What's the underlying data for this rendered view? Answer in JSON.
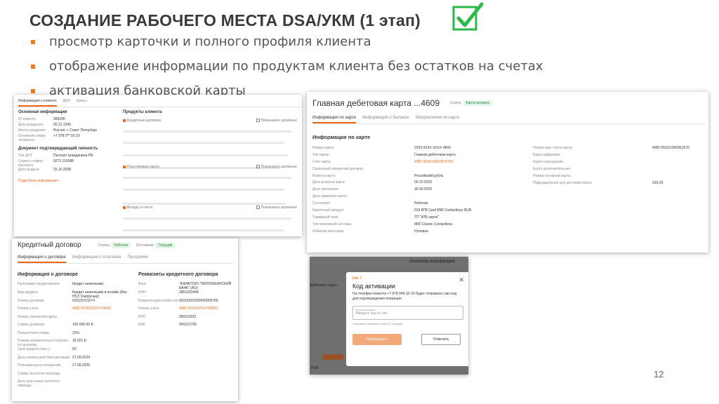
{
  "slide": {
    "title": "СОЗДАНИЕ РАБОЧЕГО МЕСТА DSA/УКМ (1 этап)",
    "bullets": [
      "просмотр карточки и полного профиля клиента",
      "отображение информации по продуктам клиента без остатков на счетах",
      "активация банковской карты"
    ],
    "page_number": "12",
    "accent_color": "#f07c1f",
    "check_color": "#2eb84a"
  },
  "client_card": {
    "tabs": [
      "Информация о клиенте",
      "ДБО",
      "Кросы"
    ],
    "basic_title": "Основная информация",
    "basic_rows": [
      {
        "label": "ID клиента",
        "value": "389290"
      },
      {
        "label": "Дата рождения",
        "value": "05.12.1990"
      },
      {
        "label": "Место рождения",
        "value": "Россия, г. Санкт-Петербург"
      },
      {
        "label": "Основной номер телефона",
        "value": "+7 978 0** 02-23"
      }
    ],
    "doc_title": "Документ подтверждающий личность",
    "doc_rows": [
      {
        "label": "Тип ДУЛ",
        "value": "Паспорт гражданина РФ"
      },
      {
        "label": "Серия и номер паспорта",
        "value": "9273 110288"
      },
      {
        "label": "Дата выдачи",
        "value": "25.10.2008"
      }
    ],
    "more_link": "Подробная информация",
    "products_title": "Продукты клиента",
    "credit_section": "Кредитные договора",
    "cards_section": "Пластиковые карты",
    "deposits_section": "Вклады и счета",
    "show_archive": "Показывать архивные"
  },
  "debit_card": {
    "title": "Главная дебетовая карта ...4609",
    "status_label": "Статус:",
    "status_value": "Карта активна",
    "tabs": [
      "Информация по карте",
      "Информация о балансе",
      "Уведомления по карте"
    ],
    "section_title": "Информация по карте",
    "left_rows": [
      {
        "label": "Номер карты",
        "value": "2200 02XX XXXX 4609"
      },
      {
        "label": "Тип карты",
        "value": "Главная дебетовая карта"
      },
      {
        "label": "Счет карты",
        "value": "40817810210003615765"
      },
      {
        "label": "Связанный кредитный договор",
        "value": ""
      },
      {
        "label": "Валюта карты",
        "value": "Российский рубль"
      },
      {
        "label": "Дата выпуска карты",
        "value": "09.10.2023"
      },
      {
        "label": "Дата окончания",
        "value": "30.09.2029"
      },
      {
        "label": "Дата закрытия карты",
        "value": ""
      },
      {
        "label": "Состояние",
        "value": "Рабочая"
      },
      {
        "label": "Карточный продукт",
        "value": "019 ATB Card MIR Contactless RUR"
      },
      {
        "label": "Тарифный план",
        "value": "ТП \"АТБ карта\""
      },
      {
        "label": "Тип платежной системы",
        "value": "MIR Classic Contactless"
      },
      {
        "label": "Иобиная категория",
        "value": "Нулевая"
      }
    ],
    "right_rows": [
      {
        "label": "Номер карт счета карты",
        "value": "4081781021000361576"
      },
      {
        "label": "Карта цифровая",
        "value": ""
      },
      {
        "label": "Карта сокращения",
        "value": ""
      },
      {
        "label": "Карта дополнительная",
        "value": ""
      },
      {
        "label": "Номер основной карты",
        "value": ""
      },
      {
        "label": "Подразделение для доставки карты",
        "value": "019-25"
      }
    ]
  },
  "credit_contract": {
    "title": "Кредитный договор",
    "status_label": "Статус:",
    "status_value": "Рабочая",
    "state_label": "Состояние:",
    "state_value": "Текущий",
    "tabs": [
      "Информация о договоре",
      "Информация о платежах",
      "Просрочки"
    ],
    "left_title": "Информация о договоре",
    "left_rows": [
      {
        "label": "Программа кредитования",
        "value": "Кредит наличными"
      },
      {
        "label": "Вид кредита",
        "value": "Кредит наличными в онлайн (Без НСЗ (Чапручка))"
      },
      {
        "label": "Номер договора",
        "value": "0151/0151074"
      },
      {
        "label": "Номер счета",
        "value": "40817810621510766581"
      },
      {
        "label": "Номер связанной карты",
        "value": ""
      },
      {
        "label": "Сумма договора",
        "value": "100 000,00 ₽"
      },
      {
        "label": "Процентная ставка",
        "value": "23%"
      },
      {
        "label": "Размер ежемесячного платежа по договору",
        "value": "18 921 ₽"
      },
      {
        "label": "Срок кредита (мес.)",
        "value": "60"
      },
      {
        "label": "Дата начала действия договора",
        "value": "27.09.2024"
      },
      {
        "label": "Плановая дата погашения",
        "value": "27.09.2029"
      },
      {
        "label": "Сумма льготного периода",
        "value": ""
      },
      {
        "label": "Дата окончания льготного периода",
        "value": ""
      }
    ],
    "right_title": "Реквизиты кредитного договора",
    "right_rows": [
      {
        "label": "Банк",
        "value": "\"АЗИАТСКО-ТИХООКЕАНСКИЙ БАНК\" (АО)"
      },
      {
        "label": "ИНН",
        "value": "2801023444"
      },
      {
        "label": "Корреспондентский счет",
        "value": "30101810300000000765"
      },
      {
        "label": "Номер счета",
        "value": "40817810621510766581"
      },
      {
        "label": "КПП",
        "value": "280101001"
      },
      {
        "label": "БИК",
        "value": "041012765"
      }
    ]
  },
  "activation": {
    "bg_header": "Основная информация",
    "bg_label": "Дебетовая карта",
    "bg_currency": "RUR",
    "step": "Шаг 2",
    "title": "Код активации",
    "text": "На телефон клиента +7 978 049-32-23 будет отправлен смс-код для подтверждения операции",
    "input_label": "Код активации",
    "input_placeholder": "Введите код из смс",
    "resend_text": "Отправить повторно через 57 секунды",
    "confirm_label": "Подтвердить",
    "cancel_label": "Отменить"
  }
}
